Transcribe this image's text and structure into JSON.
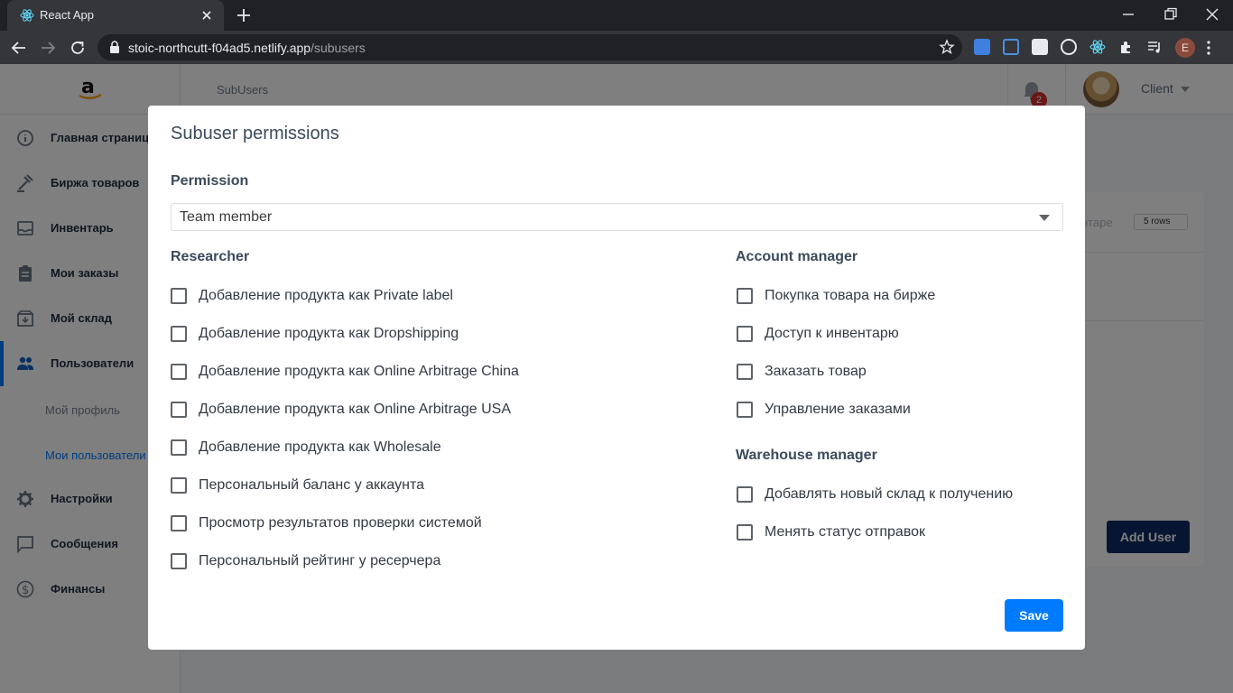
{
  "browser": {
    "tab_title": "React App",
    "url_host": "stoic-northcutt-f04ad5.netlify.app",
    "url_path": "/subusers",
    "profile_initial": "E"
  },
  "sidebar": {
    "items": [
      {
        "label": "Главная страница",
        "icon": "info-icon"
      },
      {
        "label": "Биржа товаров",
        "icon": "gavel-icon"
      },
      {
        "label": "Инвентарь",
        "icon": "inbox-icon"
      },
      {
        "label": "Мои заказы",
        "icon": "clipboard-icon"
      },
      {
        "label": "Мой склад",
        "icon": "warehouse-icon"
      },
      {
        "label": "Пользователи",
        "icon": "users-icon"
      },
      {
        "label": "Настройки",
        "icon": "gear-icon"
      },
      {
        "label": "Сообщения",
        "icon": "chat-icon"
      },
      {
        "label": "Финансы",
        "icon": "dollar-icon"
      }
    ],
    "sub_items": [
      "Мой профиль",
      "Мои пользователи"
    ]
  },
  "header": {
    "breadcrumb": "SubUsers",
    "notification_count": "2",
    "user_role": "Client"
  },
  "card": {
    "partial_text": "нтаре",
    "rows_select": "5 rows",
    "add_user_label": "Add User"
  },
  "modal": {
    "title": "Subuser permissions",
    "permission_label": "Permission",
    "permission_value": "Team member",
    "researcher": {
      "title": "Researcher",
      "items": [
        "Добавление продукта как Private label",
        "Добавление продукта как Dropshipping",
        "Добавление продукта как Online Arbitrage China",
        "Добавление продукта как Online Arbitrage USA",
        "Добавление продукта как Wholesale",
        "Персональный баланс у аккаунта",
        "Просмотр результатов проверки системой",
        "Персональный рейтинг у ресерчера"
      ]
    },
    "account_manager": {
      "title": "Account manager",
      "items": [
        "Покупка товара на бирже",
        "Доступ к инвентарю",
        "Заказать товар",
        "Управление заказами"
      ]
    },
    "warehouse_manager": {
      "title": "Warehouse manager",
      "items": [
        "Добавлять новый склад к получению",
        "Менять статус отправок"
      ]
    },
    "save_label": "Save"
  },
  "colors": {
    "accent": "#007bff",
    "add_user_bg": "#0c2b63",
    "badge": "#d32f2f"
  }
}
